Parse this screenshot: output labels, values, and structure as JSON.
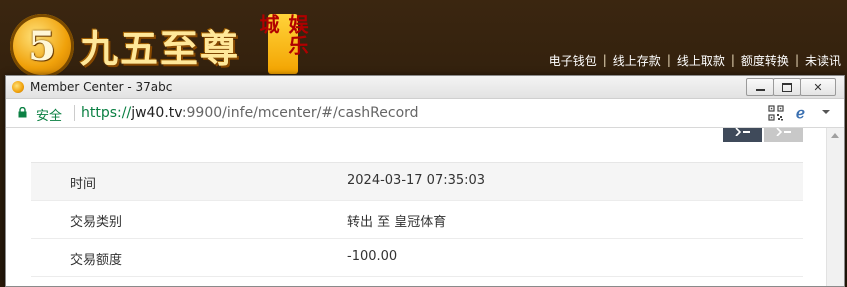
{
  "site": {
    "logo_mark": "5",
    "logo_text": "九五至尊",
    "logo_tag": "娱乐城",
    "nav_items": [
      "电子钱包",
      "线上存款",
      "线上取款",
      "额度转换",
      "未读讯"
    ],
    "nav_separator": "|"
  },
  "window": {
    "title": "Member Center - 37abc",
    "close_glyph": "✕"
  },
  "address_bar": {
    "secure_label": "安全",
    "url_scheme": "https://",
    "url_host": "jw40.tv",
    "url_rest": ":9900/infe/mcenter/#/cashRecord"
  },
  "record": {
    "rows": [
      {
        "label": "时间",
        "value": "2024-03-17 07:35:03"
      },
      {
        "label": "交易类别",
        "value": "转出 至 皇冠体育"
      },
      {
        "label": "交易额度",
        "value": "-100.00"
      }
    ]
  },
  "colors": {
    "secure_green": "#0b8043",
    "tab_dark": "#3f4a5a",
    "tab_light": "#c8c8c8",
    "header_brown": "#3b2610"
  }
}
